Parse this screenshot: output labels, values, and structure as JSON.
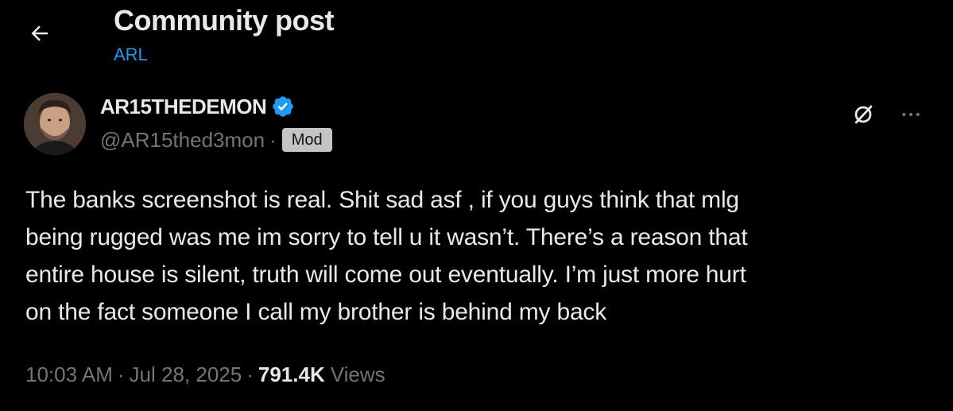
{
  "header": {
    "title": "Community post",
    "community": "ARL",
    "back_icon": "arrow-left-icon"
  },
  "post": {
    "author": {
      "name": "AR15THEDEMON",
      "handle": "@AR15thed3mon",
      "separator": "·",
      "badge": "Mod",
      "verified_icon": "verified-badge-icon",
      "verified_color": "#1d9bf0"
    },
    "actions": {
      "grok_icon": "grok-icon",
      "more_icon": "more-horizontal-icon"
    },
    "text_lines": [
      "The banks screenshot is real. Shit sad asf , if you guys think that mlg",
      "being rugged was me im sorry to tell u it wasn’t. There’s a reason that",
      "entire house is silent, truth will come out eventually. I’m just more hurt",
      "on the fact someone I call my brother is behind my back"
    ],
    "meta": {
      "time": "10:03 AM",
      "sep": "·",
      "date": "Jul 28, 2025",
      "views_count": "791.4K",
      "views_label": "Views"
    }
  },
  "colors": {
    "background": "#000000",
    "text": "#e7e9ea",
    "secondary": "#71767b",
    "accent": "#1d9bf0",
    "badge_bg": "#c4c4c4"
  }
}
